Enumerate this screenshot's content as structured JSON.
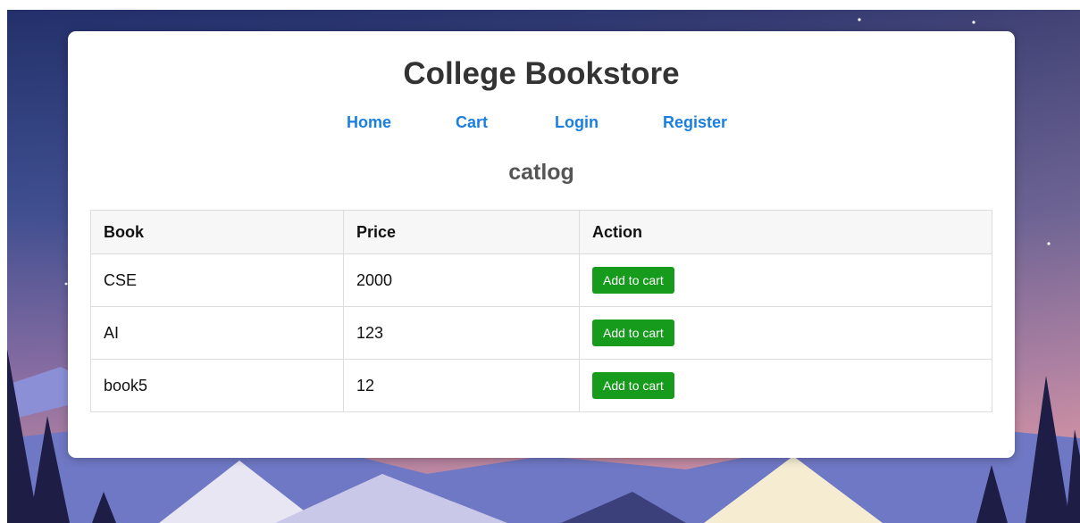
{
  "header": {
    "title": "College Bookstore"
  },
  "nav": {
    "items": [
      {
        "label": "Home"
      },
      {
        "label": "Cart"
      },
      {
        "label": "Login"
      },
      {
        "label": "Register"
      }
    ]
  },
  "catalog": {
    "heading": "catlog",
    "columns": [
      "Book",
      "Price",
      "Action"
    ],
    "rows": [
      {
        "book": "CSE",
        "price": "2000",
        "action_label": "Add to cart"
      },
      {
        "book": "AI",
        "price": "123",
        "action_label": "Add to cart"
      },
      {
        "book": "book5",
        "price": "12",
        "action_label": "Add to cart"
      }
    ]
  },
  "colors": {
    "nav_link": "#1a7fe0",
    "add_button": "#179b1c",
    "title_text": "#333333"
  }
}
